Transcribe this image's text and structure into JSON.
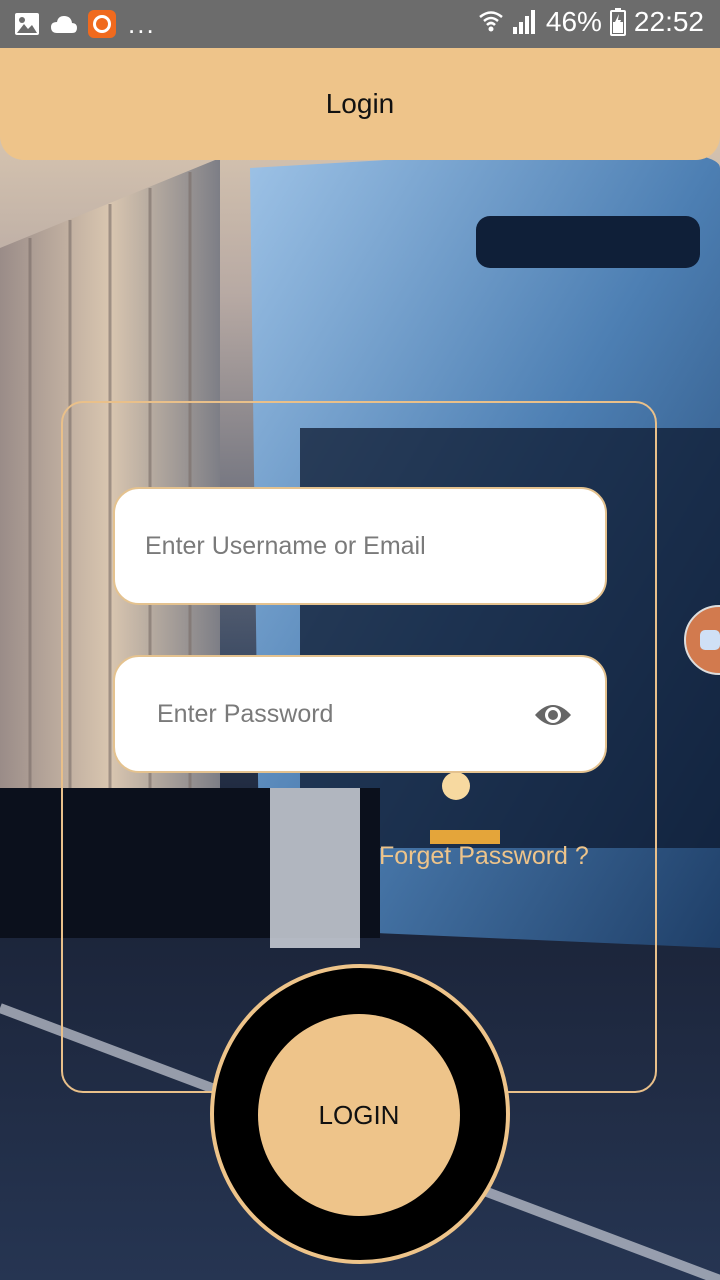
{
  "status_bar": {
    "dots": "...",
    "battery": "46%",
    "time": "22:52"
  },
  "app_bar": {
    "title": "Login"
  },
  "form": {
    "username_placeholder": "Enter Username or Email",
    "password_placeholder": "Enter Password",
    "forgot_label": "Forget Password ?",
    "login_label": "LOGIN"
  },
  "colors": {
    "accent": "#eec48a",
    "status_bar_bg": "#6c6c6c",
    "ring": "#000000"
  },
  "icons": {
    "eye": "eye-icon",
    "status": [
      "image-icon",
      "cloud-icon",
      "screen-recorder-icon",
      "wifi-icon",
      "signal-icon",
      "battery-icon"
    ]
  }
}
